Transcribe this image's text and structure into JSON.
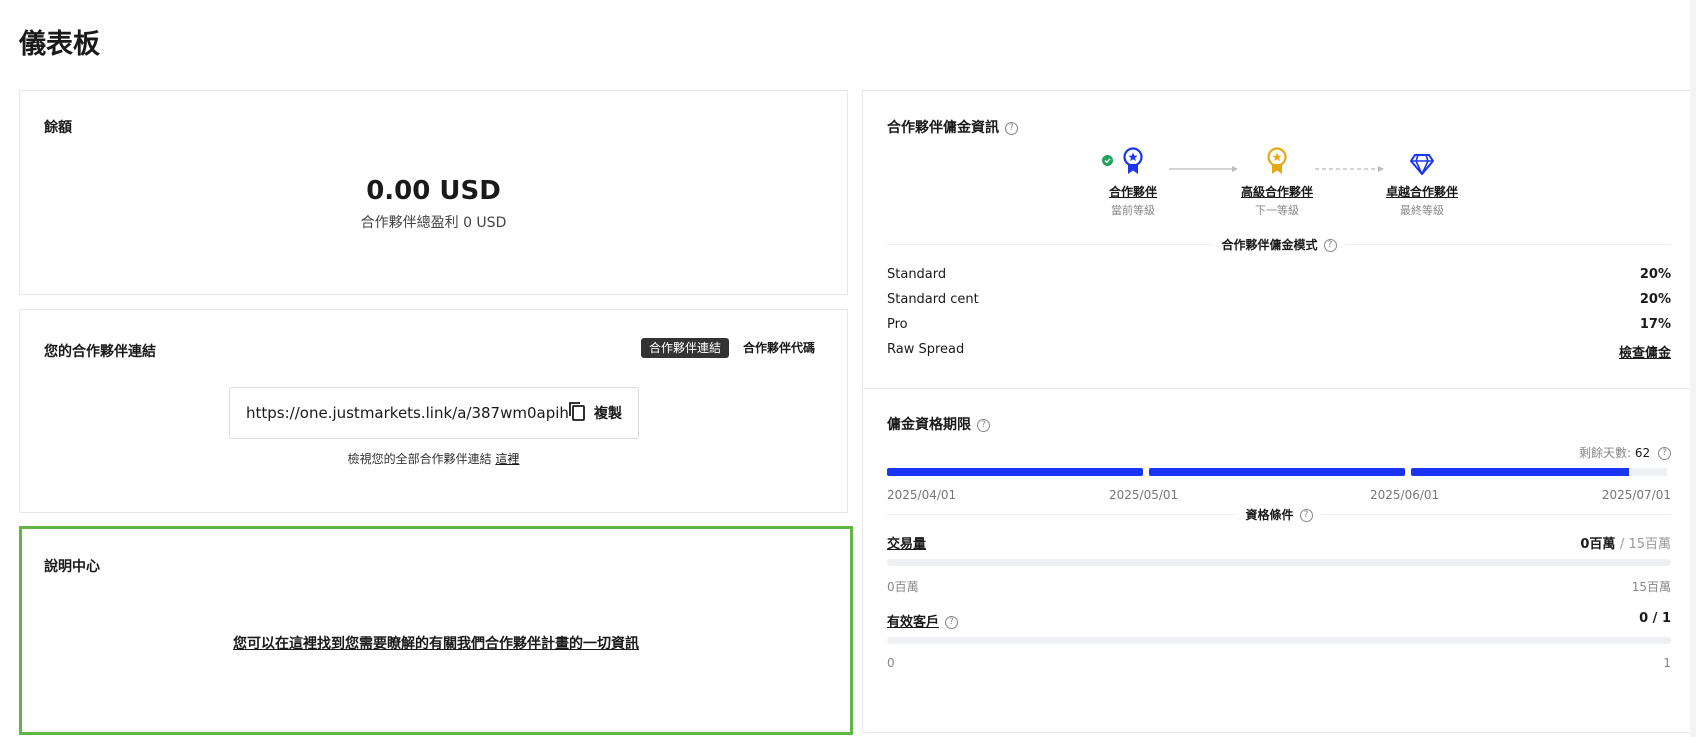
{
  "page": {
    "title": "儀表板"
  },
  "balance": {
    "title": "餘額",
    "amount": "0.00 USD",
    "subtitle": "合作夥伴總盈利 0 USD"
  },
  "partner_link": {
    "title": "您的合作夥伴連結",
    "tabs": [
      "合作夥伴連結",
      "合作夥伴代碼"
    ],
    "active_tab": 0,
    "url": "https://one.justmarkets.link/a/387wm0apih",
    "copy_label": "複製",
    "view_all_text": "檢視您的全部合作夥伴連結",
    "view_all_link": "這裡"
  },
  "help_center": {
    "title": "說明中心",
    "link_text": "您可以在這裡找到您需要瞭解的有關我們合作夥伴計畫的一切資訊"
  },
  "commission": {
    "title": "合作夥伴傭金資訊",
    "levels": [
      {
        "name": "合作夥伴",
        "sub": "當前等級",
        "icon": "blue-medal-icon",
        "color": "#1a36f2",
        "current": true
      },
      {
        "name": "高級合作夥伴",
        "sub": "下一等級",
        "icon": "gold-medal-icon",
        "color": "#e6a817",
        "current": false
      },
      {
        "name": "卓越合作夥伴",
        "sub": "最終等級",
        "icon": "diamond-icon",
        "color": "#1a36f2",
        "current": false
      }
    ],
    "mode_title": "合作夥伴傭金模式",
    "rates": [
      {
        "label": "Standard",
        "value": "20%"
      },
      {
        "label": "Standard cent",
        "value": "20%"
      },
      {
        "label": "Pro",
        "value": "17%"
      },
      {
        "label": "Raw Spread",
        "value": "檢查傭金",
        "is_link": true
      }
    ]
  },
  "eligibility": {
    "title": "傭金資格期限",
    "days_left_label": "剩餘天數:",
    "days_left_value": "62",
    "period_progress": 0.95,
    "dates": [
      "2025/04/01",
      "2025/05/01",
      "2025/06/01",
      "2025/07/01"
    ],
    "conditions_title": "資格條件",
    "volume": {
      "label": "交易量",
      "current": "0百萬",
      "total": "15百萬",
      "min": "0百萬",
      "max": "15百萬",
      "progress": 0
    },
    "clients": {
      "label": "有效客戶",
      "value": "0 / 1",
      "min": "0",
      "max": "1",
      "progress": 0
    }
  },
  "colors": {
    "accent": "#1a36f2",
    "highlight_border": "#5fb644",
    "gold": "#e6a817",
    "success": "#22a35a"
  }
}
